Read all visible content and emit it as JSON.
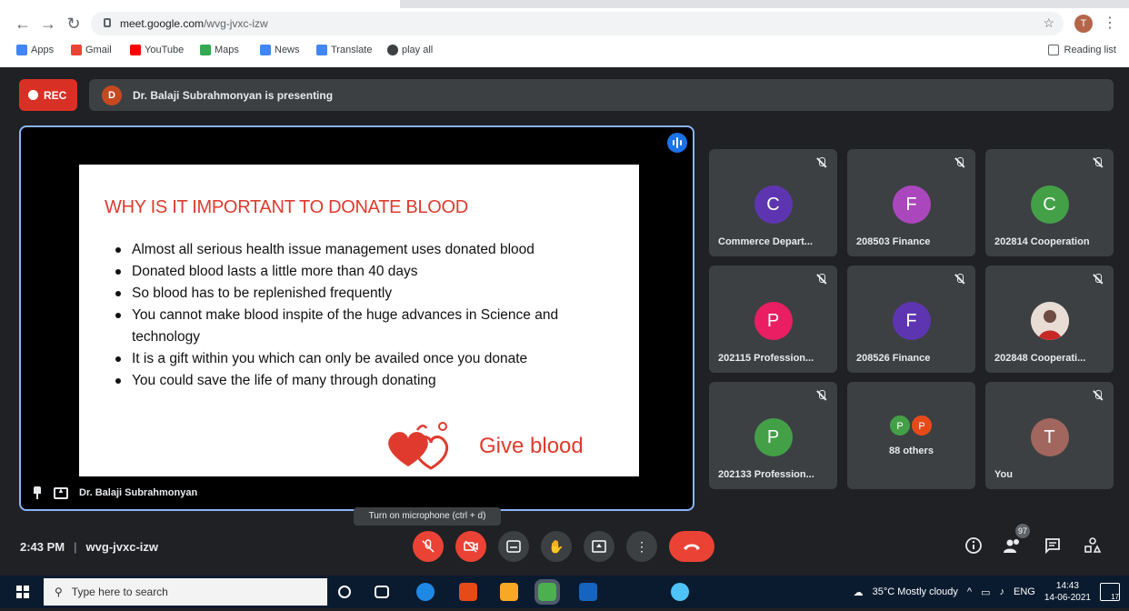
{
  "browser": {
    "url_host": "meet.google.com",
    "url_path": "/wvg-jvxc-izw",
    "profile_initial": "T",
    "bookmarks": [
      {
        "label": "Apps",
        "color": "#4285f4"
      },
      {
        "label": "Gmail",
        "color": "#ea4335"
      },
      {
        "label": "YouTube",
        "color": "#ff0000"
      },
      {
        "label": "Maps",
        "color": "#34a853"
      },
      {
        "label": "News",
        "color": "#4285f4"
      },
      {
        "label": "Translate",
        "color": "#4285f4"
      },
      {
        "label": "play all",
        "color": "#3c4043"
      }
    ],
    "reading_list": "Reading list"
  },
  "meet": {
    "rec_label": "REC",
    "presenter_initial": "D",
    "presenting_text": "Dr. Balaji Subrahmonyan is presenting",
    "main_tile_name": "Dr. Balaji Subrahmonyan",
    "slide": {
      "title": "WHY IS IT IMPORTANT TO DONATE BLOOD",
      "bullets": [
        "Almost all serious health issue management uses donated blood",
        "Donated blood lasts a little more than 40 days",
        "So blood has to be replenished frequently",
        "You cannot make blood inspite of the huge advances in Science and technology",
        "It is a gift within you which can only be availed once you donate",
        "You could save the life of many through donating"
      ],
      "logo_text": "Give blood"
    },
    "participants": [
      {
        "initial": "C",
        "name": "Commerce Depart...",
        "color": "#5e35b1"
      },
      {
        "initial": "F",
        "name": "208503 Finance",
        "color": "#ab47bc"
      },
      {
        "initial": "C",
        "name": "202814 Cooperation",
        "color": "#43a047"
      },
      {
        "initial": "P",
        "name": "202115 Profession...",
        "color": "#e91e63"
      },
      {
        "initial": "F",
        "name": "208526 Finance",
        "color": "#5e35b1"
      },
      {
        "initial": "",
        "name": "202848 Cooperati...",
        "color": "#d7ccc8"
      },
      {
        "initial": "P",
        "name": "202133 Profession...",
        "color": "#43a047"
      },
      {
        "initial": "T",
        "name": "You",
        "color": "#a1665e"
      }
    ],
    "others": {
      "label": "88 others",
      "avatars": [
        {
          "initial": "P",
          "color": "#43a047"
        },
        {
          "initial": "P",
          "color": "#e64a19"
        }
      ]
    },
    "tooltip": "Turn on microphone (ctrl + d)",
    "time": "2:43 PM",
    "meeting_code": "wvg-jvxc-izw",
    "participant_count": "97"
  },
  "taskbar": {
    "search_placeholder": "Type here to search",
    "weather": "35°C  Mostly cloudy",
    "language": "ENG",
    "time": "14:43",
    "date": "14-06-2021",
    "notification_count": "17"
  }
}
